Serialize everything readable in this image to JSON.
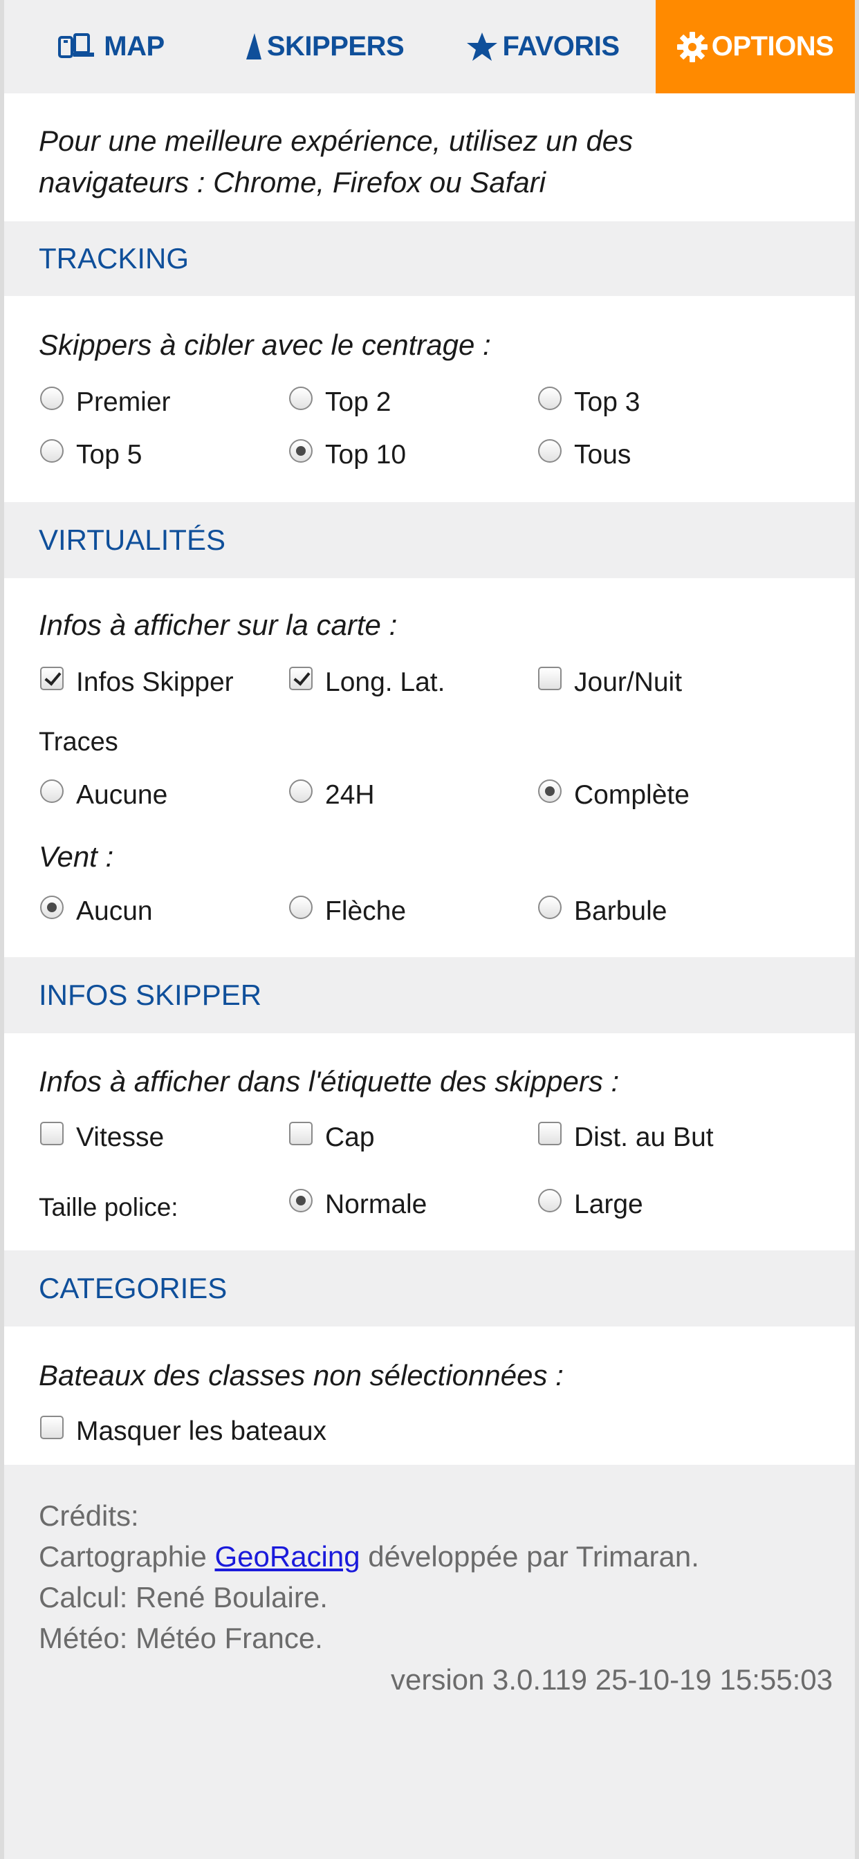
{
  "tabs": {
    "map": "MAP",
    "skippers": "SKIPPERS",
    "favoris": "FAVORIS",
    "options": "OPTIONS"
  },
  "browser_notice": {
    "line1": "Pour une meilleure expérience, utilisez un des",
    "line2": "navigateurs : Chrome, Firefox ou Safari"
  },
  "tracking": {
    "header": "TRACKING",
    "prompt": "Skippers à cibler avec le centrage :",
    "options": [
      "Premier",
      "Top 2",
      "Top 3",
      "Top 5",
      "Top 10",
      "Tous"
    ],
    "selected": "Top 10"
  },
  "virtualites": {
    "header": "VIRTUALITÉS",
    "prompt": "Infos à afficher sur la carte :",
    "checks": [
      {
        "label": "Infos Skipper",
        "checked": true
      },
      {
        "label": "Long. Lat.",
        "checked": true
      },
      {
        "label": "Jour/Nuit",
        "checked": false
      }
    ],
    "traces_label": "Traces",
    "traces_options": [
      "Aucune",
      "24H",
      "Complète"
    ],
    "traces_selected": "Complète",
    "vent_label": "Vent :",
    "vent_options": [
      "Aucun",
      "Flèche",
      "Barbule"
    ],
    "vent_selected": "Aucun"
  },
  "infos_skipper": {
    "header": "INFOS SKIPPER",
    "prompt": "Infos à afficher dans l'étiquette des skippers :",
    "checks": [
      {
        "label": "Vitesse",
        "checked": false
      },
      {
        "label": "Cap",
        "checked": false
      },
      {
        "label": "Dist. au But",
        "checked": false
      }
    ],
    "font_size_label": "Taille police:",
    "font_options": [
      "Normale",
      "Large"
    ],
    "font_selected": "Normale"
  },
  "categories": {
    "header": "CATEGORIES",
    "prompt": "Bateaux des classes non sélectionnées :",
    "hide_boats_label": "Masquer les bateaux",
    "hide_boats_checked": false
  },
  "credits": {
    "title": "Crédits:",
    "cartography_prefix": "Cartographie ",
    "cartography_link": "GeoRacing",
    "cartography_suffix": " développée par Trimaran.",
    "calcul": "Calcul: René Boulaire.",
    "meteo": "Météo: Météo France.",
    "version": "version 3.0.119 25-10-19 15:55:03"
  },
  "colors": {
    "accent": "#ff8a00",
    "header_text": "#0f4f9a",
    "link": "#1a1adb"
  },
  "icons": {
    "map": "devices-icon",
    "skippers": "sail-icon",
    "favoris": "star-icon",
    "options": "gear-icon"
  }
}
